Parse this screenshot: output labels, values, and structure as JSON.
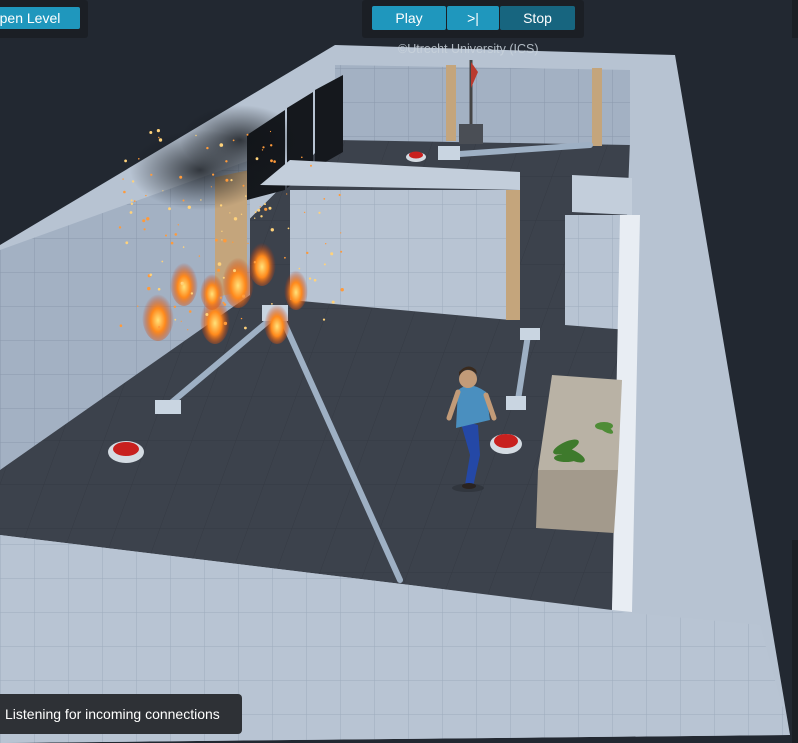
{
  "toolbar": {
    "open_level_label": "pen Level",
    "play_label": "Play",
    "step_label": ">|",
    "stop_label": "Stop"
  },
  "copyright": "©Utrecht University (ICS)",
  "status": {
    "message": "Listening for incoming connections"
  },
  "scene": {
    "agent": "person",
    "hazards": [
      "fire"
    ],
    "objects": [
      "buttons",
      "levers",
      "doors",
      "table",
      "plants",
      "windows",
      "flag"
    ]
  },
  "colors": {
    "button_active": "#1f97bd",
    "button_dark": "#17657f",
    "panel_bg": "#1b1f25",
    "wall": "#a9b6c6",
    "floor": "#3d434d",
    "fire": "#ff7a1a",
    "pressure_button": "#c8201e"
  }
}
